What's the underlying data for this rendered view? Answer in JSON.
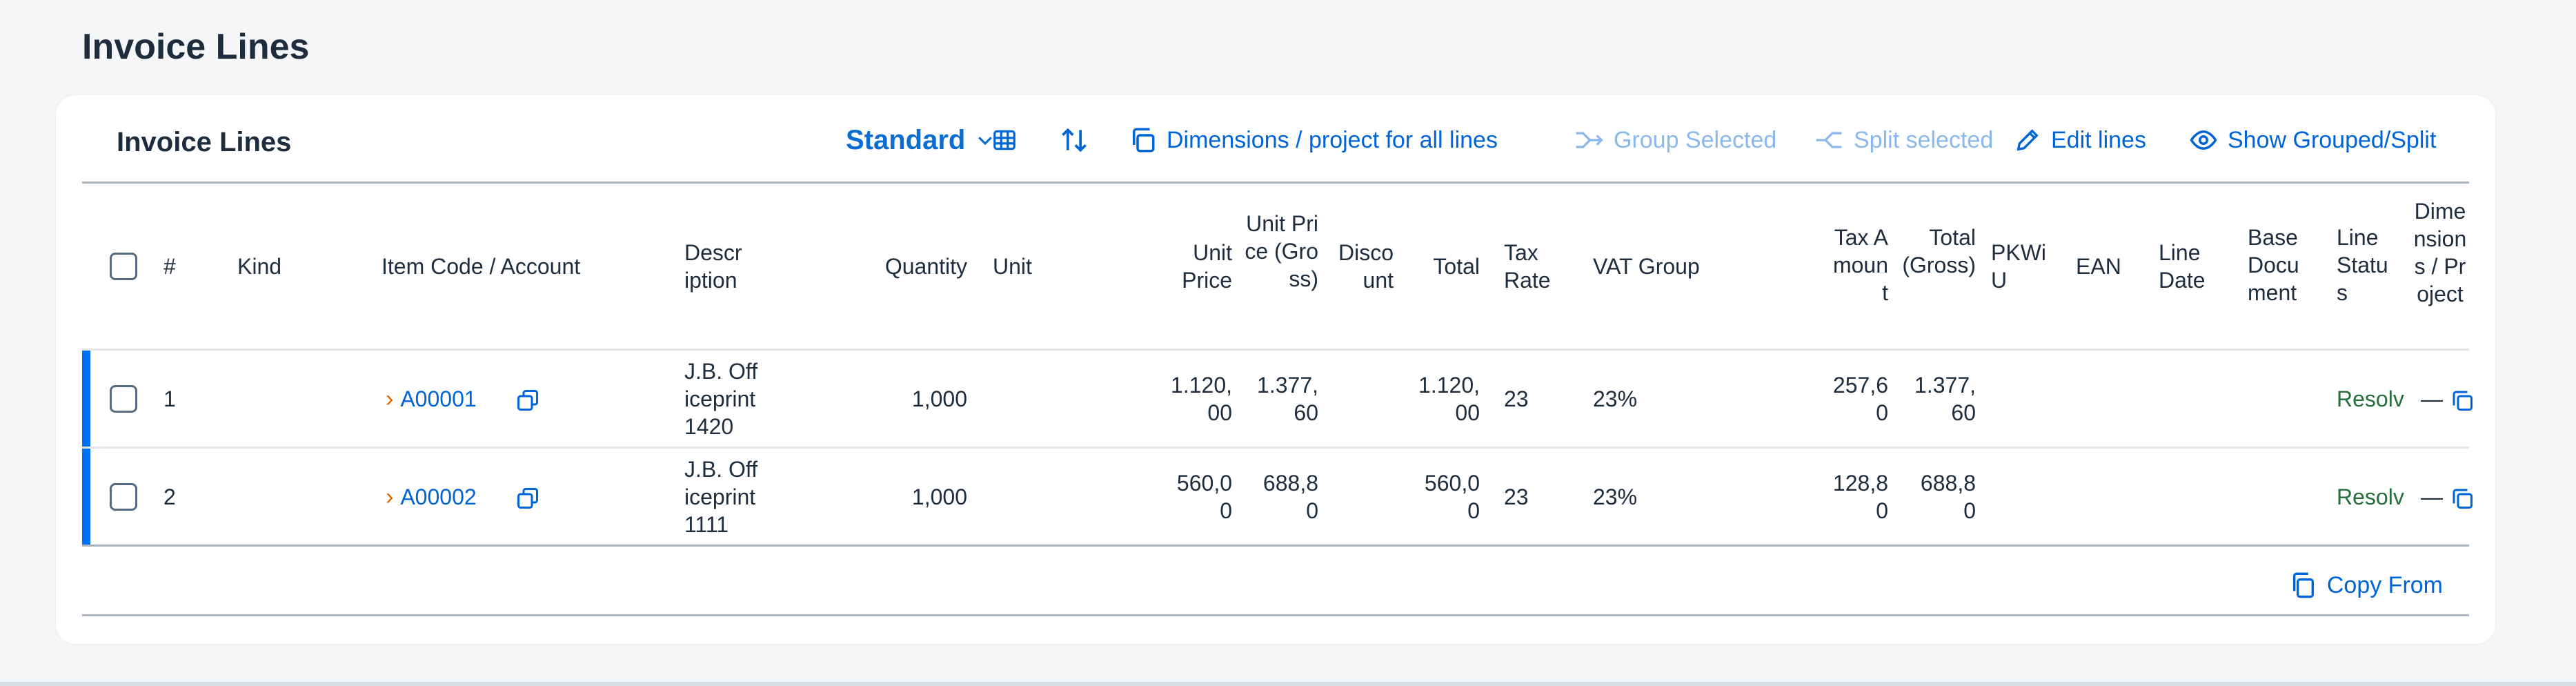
{
  "page": {
    "title": "Invoice Lines"
  },
  "toolbar": {
    "title": "Invoice Lines",
    "variant": "Standard",
    "dimensions_label": "Dimensions / project for all lines",
    "group_label": "Group Selected",
    "split_label": "Split selected",
    "edit_label": "Edit lines",
    "show_grouped_label": "Show Grouped/Split"
  },
  "columns": {
    "num": "#",
    "kind": "Kind",
    "item_code": "Item Code / Account",
    "description": "Description",
    "quantity": "Quantity",
    "unit": "Unit",
    "unit_price": "Unit Price",
    "unit_price_gross": "Unit Price (Gross)",
    "discount": "Discount",
    "total": "Total",
    "tax_rate": "Tax Rate",
    "vat_group": "VAT Group",
    "tax_amount": "Tax Amount",
    "total_gross": "Total (Gross)",
    "pkwiu": "PKWiU",
    "ean": "EAN",
    "line_date": "Line Date",
    "base_document": "Base Document",
    "line_status": "Line Status",
    "dimensions": "Dimensions / Project"
  },
  "rows": [
    {
      "num": "1",
      "item_code": "A00001",
      "description": "J.B. Officeprint 1420",
      "quantity": "1,000",
      "unit_price": "1.120,00",
      "unit_price_gross": "1.377,60",
      "total": "1.120,00",
      "tax_rate": "23",
      "vat_group": "23%",
      "tax_amount": "257,60",
      "total_gross": "1.377,60",
      "line_status": "Resolv",
      "dimensions": "—"
    },
    {
      "num": "2",
      "item_code": "A00002",
      "description": "J.B. Officeprint 1111",
      "quantity": "1,000",
      "unit_price": "560,00",
      "unit_price_gross": "688,80",
      "total": "560,00",
      "tax_rate": "23",
      "vat_group": "23%",
      "tax_amount": "128,80",
      "total_gross": "688,80",
      "line_status": "Resolv",
      "dimensions": "—"
    }
  ],
  "footer": {
    "copy_from_label": "Copy From"
  }
}
